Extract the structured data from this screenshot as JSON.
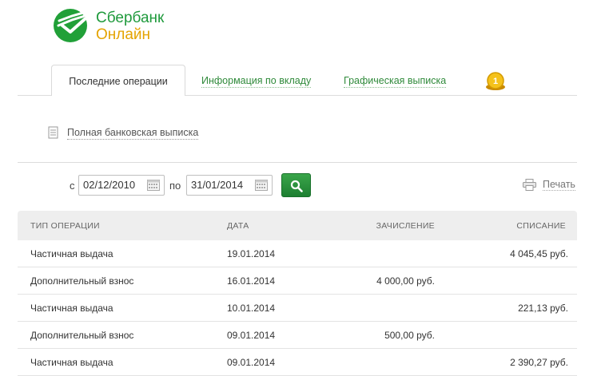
{
  "logo": {
    "line1": "Сбербанк",
    "line2": "Онлайн"
  },
  "tabs": [
    {
      "label": "Последние операции",
      "active": true
    },
    {
      "label": "Информация по вкладу",
      "active": false
    },
    {
      "label": "Графическая выписка",
      "active": false
    }
  ],
  "full_statement_label": "Полная банковская выписка",
  "filter": {
    "from_label": "с",
    "from_value": "02/12/2010",
    "to_label": "по",
    "to_value": "31/01/2014"
  },
  "print_label": "Печать",
  "table": {
    "headers": [
      "ТИП ОПЕРАЦИИ",
      "ДАТА",
      "ЗАЧИСЛЕНИЕ",
      "СПИСАНИЕ"
    ],
    "rows": [
      {
        "type": "Частичная выдача",
        "date": "19.01.2014",
        "credit": "",
        "debit": "4 045,45 руб."
      },
      {
        "type": "Дополнительный взнос",
        "date": "16.01.2014",
        "credit": "4 000,00 руб.",
        "debit": ""
      },
      {
        "type": "Частичная выдача",
        "date": "10.01.2014",
        "credit": "",
        "debit": "221,13 руб."
      },
      {
        "type": "Дополнительный взнос",
        "date": "09.01.2014",
        "credit": "500,00 руб.",
        "debit": ""
      },
      {
        "type": "Частичная выдача",
        "date": "09.01.2014",
        "credit": "",
        "debit": "2 390,27 руб."
      }
    ]
  },
  "colors": {
    "brand_green": "#1f9a3c",
    "brand_yellow": "#e4a300",
    "link_green": "#2f8a3a"
  },
  "icons": [
    "sberbank-logo-icon",
    "coin-icon",
    "document-icon",
    "calendar-icon",
    "search-icon",
    "printer-icon"
  ]
}
